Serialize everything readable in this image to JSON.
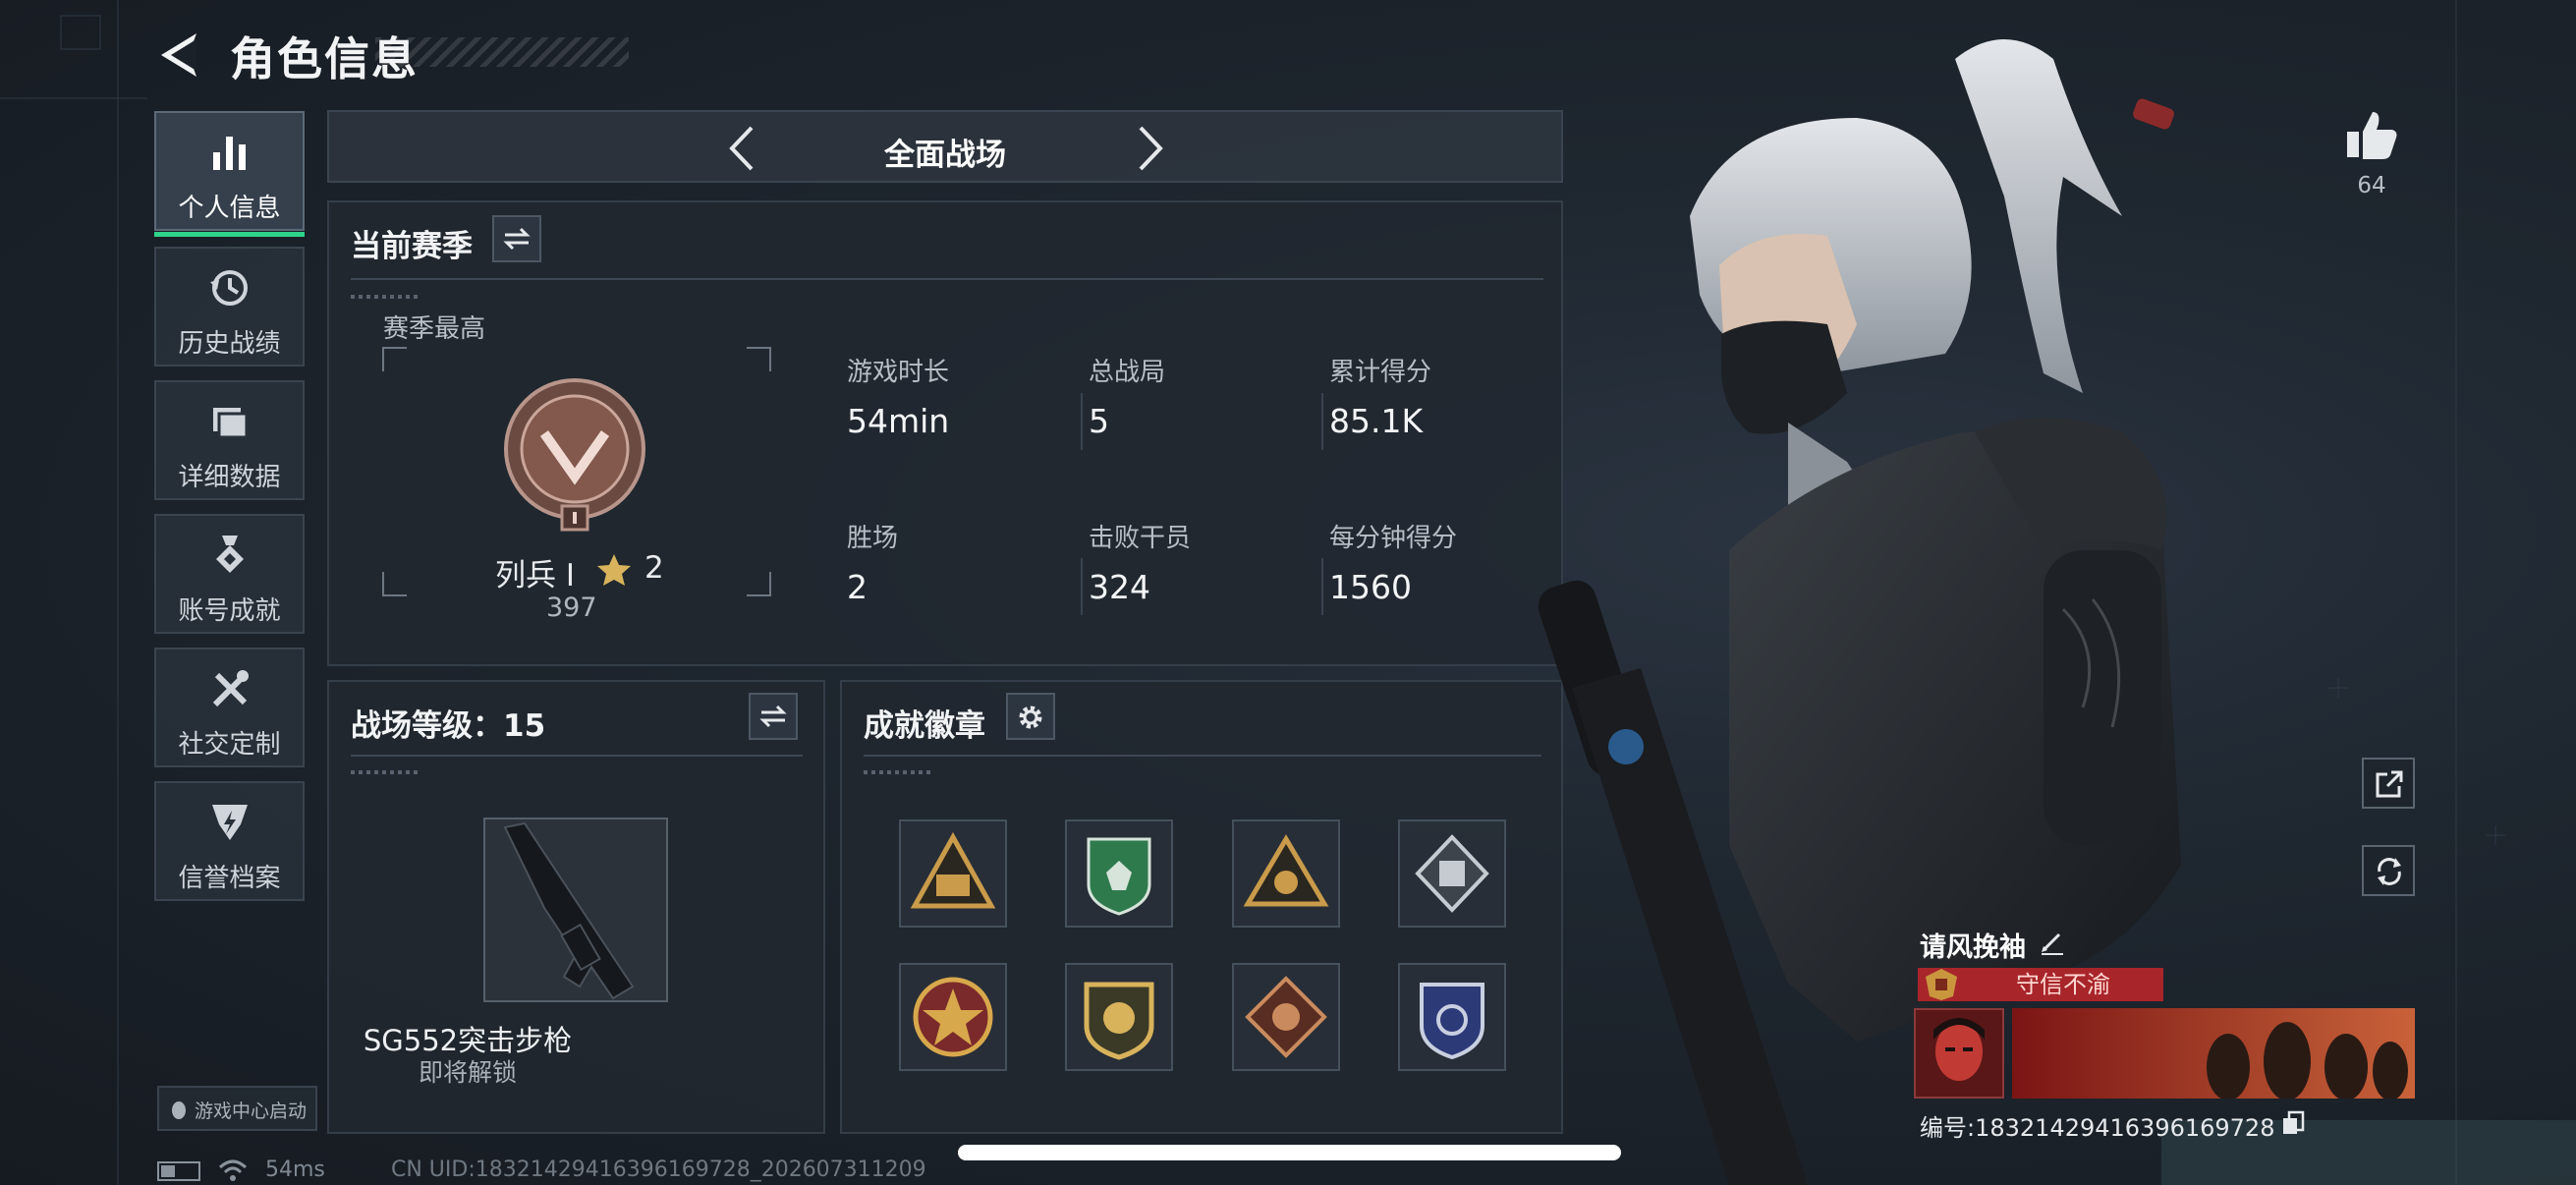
{
  "header": {
    "title": "角色信息"
  },
  "nav": {
    "items": [
      {
        "label": "个人信息",
        "active": true,
        "icon": "bar-chart-icon"
      },
      {
        "label": "历史战绩",
        "active": false,
        "icon": "history-icon"
      },
      {
        "label": "详细数据",
        "active": false,
        "icon": "folder-icon"
      },
      {
        "label": "账号成就",
        "active": false,
        "icon": "medal-icon"
      },
      {
        "label": "社交定制",
        "active": false,
        "icon": "tools-icon"
      },
      {
        "label": "信誉档案",
        "active": false,
        "icon": "credit-icon"
      }
    ],
    "game_center": "游戏中心启动"
  },
  "mode": {
    "label": "全面战场"
  },
  "season": {
    "title": "当前赛季",
    "best_label": "赛季最高",
    "rank": {
      "name": "列兵 Ⅰ",
      "stars": "2",
      "score": "397"
    },
    "stats": [
      {
        "label": "游戏时长",
        "value": "54min"
      },
      {
        "label": "总战局",
        "value": "5"
      },
      {
        "label": "累计得分",
        "value": "85.1K"
      },
      {
        "label": "胜场",
        "value": "2"
      },
      {
        "label": "击败干员",
        "value": "324"
      },
      {
        "label": "每分钟得分",
        "value": "1560"
      }
    ]
  },
  "battlefield": {
    "level_label": "战场等级：15",
    "weapon_name": "SG552突击步枪",
    "weapon_status": "即将解锁"
  },
  "achievements": {
    "title": "成就徽章",
    "badges": [
      "badge-1",
      "badge-2",
      "badge-3",
      "badge-4",
      "badge-5",
      "badge-6",
      "badge-7",
      "badge-8"
    ]
  },
  "profile": {
    "likes": "64",
    "player_name": "请风挽袖",
    "honor_title": "守信不渝",
    "uid_line": "编号:18321429416396169728"
  },
  "status": {
    "ping": "54ms",
    "uid_footer": "CN UID:18321429416396169728_202607311209"
  },
  "colors": {
    "accent": "#2fd48a",
    "honor": "#a8252a",
    "panel": "#212830"
  }
}
